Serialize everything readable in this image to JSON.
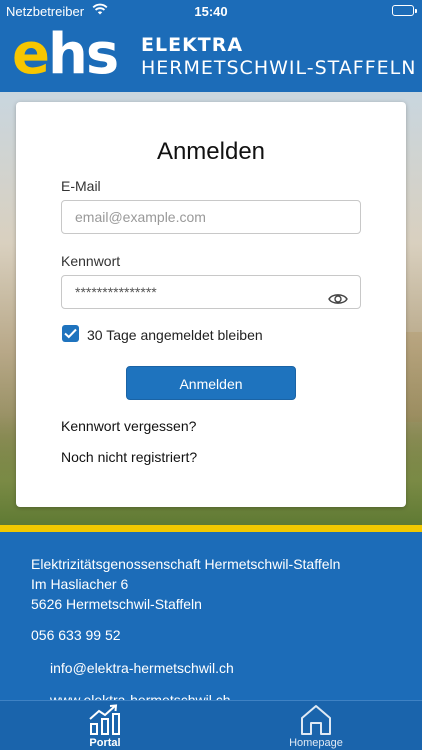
{
  "status_bar": {
    "carrier": "Netzbetreiber",
    "time": "15:40"
  },
  "header": {
    "logo_e": "e",
    "logo_hs": "hs",
    "brand_line1": "ELEKTRA",
    "brand_line2": "HERMETSCHWIL-STAFFELN"
  },
  "login": {
    "title": "Anmelden",
    "email_label": "E-Mail",
    "email_placeholder": "email@example.com",
    "password_label": "Kennwort",
    "password_value": "***************",
    "remember_label": "30 Tage angemeldet bleiben",
    "remember_checked": true,
    "submit_label": "Anmelden",
    "forgot_link": "Kennwort vergessen?",
    "register_link": "Noch nicht registriert?"
  },
  "footer": {
    "org_name": "Elektrizitätsgenossenschaft Hermetschwil-Staffeln",
    "street": "Im Hasliacher 6",
    "city": "5626 Hermetschwil-Staffeln",
    "phone": "056 633 99 52",
    "email": "info@elektra-hermetschwil.ch",
    "website": "www.elektra-hermetschwil.ch"
  },
  "tabs": [
    {
      "label": "Portal",
      "icon": "chart-icon",
      "active": true
    },
    {
      "label": "Homepage",
      "icon": "home-icon",
      "active": false
    }
  ],
  "colors": {
    "brand_blue": "#1c6cb8",
    "accent_yellow": "#f1c800",
    "button_blue": "#1e73be"
  }
}
